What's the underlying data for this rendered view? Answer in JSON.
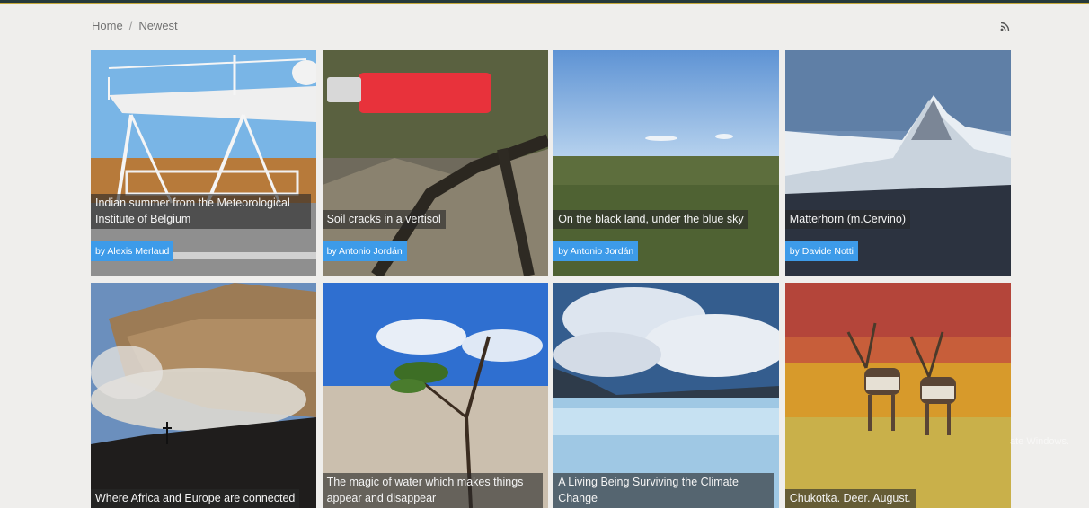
{
  "breadcrumb": {
    "home": "Home",
    "separator": "/",
    "current": "Newest"
  },
  "rss_icon": "rss-icon",
  "cards": [
    {
      "caption": "Indian summer from the Meteorological Institute of Belgium",
      "author": "by Alexis Merlaud"
    },
    {
      "caption": "Soil cracks in a vertisol",
      "author": "by Antonio Jordán"
    },
    {
      "caption": "On the black land, under the blue sky",
      "author": "by Antonio Jordán"
    },
    {
      "caption": "Matterhorn (m.Cervino)",
      "author": "by Davide Notti"
    },
    {
      "caption": "Where Africa and Europe are connected"
    },
    {
      "caption": "The magic of water which makes things appear and disappear"
    },
    {
      "caption": "A Living Being Surviving the Climate Change"
    },
    {
      "caption": "Chukotka. Deer. August."
    }
  ],
  "watermark": "ate Windows.",
  "colors": {
    "background": "#efeeec",
    "byline": "#3d9be9",
    "caption_bg": "rgba(40,40,40,0.62)"
  }
}
